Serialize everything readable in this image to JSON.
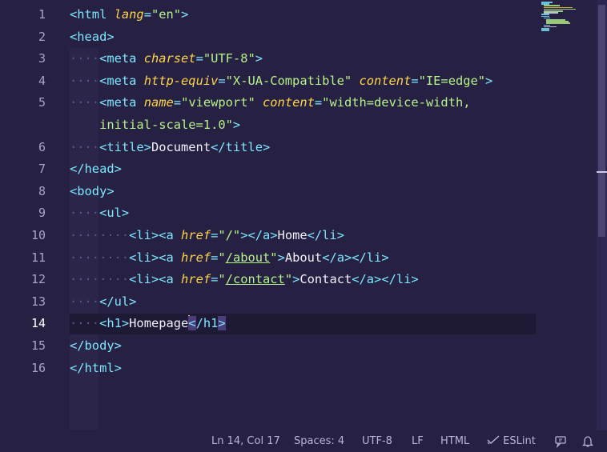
{
  "editor": {
    "line_numbers": [
      "1",
      "2",
      "3",
      "4",
      "5",
      "",
      "6",
      "7",
      "8",
      "9",
      "10",
      "11",
      "12",
      "13",
      "14",
      "15",
      "16"
    ],
    "active_line": "14",
    "lines": [
      [
        {
          "t": "tag",
          "v": "<html"
        },
        {
          "t": "plain",
          "v": " "
        },
        {
          "t": "attr",
          "v": "lang"
        },
        {
          "t": "tag",
          "v": "="
        },
        {
          "t": "str",
          "v": "\"en\""
        },
        {
          "t": "tag",
          "v": ">"
        }
      ],
      [
        {
          "t": "tag",
          "v": "<head>"
        }
      ],
      [
        {
          "t": "ws",
          "v": "····"
        },
        {
          "t": "tag",
          "v": "<meta"
        },
        {
          "t": "plain",
          "v": " "
        },
        {
          "t": "attr",
          "v": "charset"
        },
        {
          "t": "tag",
          "v": "="
        },
        {
          "t": "str",
          "v": "\"UTF-8\""
        },
        {
          "t": "tag",
          "v": ">"
        }
      ],
      [
        {
          "t": "ws",
          "v": "····"
        },
        {
          "t": "tag",
          "v": "<meta"
        },
        {
          "t": "plain",
          "v": " "
        },
        {
          "t": "attr",
          "v": "http-equiv"
        },
        {
          "t": "tag",
          "v": "="
        },
        {
          "t": "str",
          "v": "\"X-UA-Compatible\""
        },
        {
          "t": "plain",
          "v": " "
        },
        {
          "t": "attr",
          "v": "content"
        },
        {
          "t": "tag",
          "v": "="
        },
        {
          "t": "str",
          "v": "\"IE=edge\""
        },
        {
          "t": "tag",
          "v": ">"
        }
      ],
      [
        {
          "t": "ws",
          "v": "····"
        },
        {
          "t": "tag",
          "v": "<meta"
        },
        {
          "t": "plain",
          "v": " "
        },
        {
          "t": "attr",
          "v": "name"
        },
        {
          "t": "tag",
          "v": "="
        },
        {
          "t": "str",
          "v": "\"viewport\""
        },
        {
          "t": "plain",
          "v": " "
        },
        {
          "t": "attr",
          "v": "content"
        },
        {
          "t": "tag",
          "v": "="
        },
        {
          "t": "str",
          "v": "\"width=device-width,"
        }
      ],
      [
        {
          "t": "plain",
          "v": "    "
        },
        {
          "t": "str",
          "v": "initial-scale=1.0\""
        },
        {
          "t": "tag",
          "v": ">"
        }
      ],
      [
        {
          "t": "ws",
          "v": "····"
        },
        {
          "t": "tag",
          "v": "<title>"
        },
        {
          "t": "txt",
          "v": "Document"
        },
        {
          "t": "tag",
          "v": "</title>"
        }
      ],
      [
        {
          "t": "tag",
          "v": "</head>"
        }
      ],
      [
        {
          "t": "tag",
          "v": "<body>"
        }
      ],
      [
        {
          "t": "ws",
          "v": "····"
        },
        {
          "t": "tag",
          "v": "<ul>"
        }
      ],
      [
        {
          "t": "ws",
          "v": "········"
        },
        {
          "t": "tag",
          "v": "<li><a"
        },
        {
          "t": "plain",
          "v": " "
        },
        {
          "t": "attr",
          "v": "href"
        },
        {
          "t": "tag",
          "v": "="
        },
        {
          "t": "str",
          "v": "\"/\""
        },
        {
          "t": "tag",
          "v": "></a>"
        },
        {
          "t": "txt",
          "v": "Home"
        },
        {
          "t": "tag",
          "v": "</li>"
        }
      ],
      [
        {
          "t": "ws",
          "v": "········"
        },
        {
          "t": "tag",
          "v": "<li><a"
        },
        {
          "t": "plain",
          "v": " "
        },
        {
          "t": "attr",
          "v": "href"
        },
        {
          "t": "tag",
          "v": "="
        },
        {
          "t": "str",
          "v": "\""
        },
        {
          "t": "strul",
          "v": "/about"
        },
        {
          "t": "str",
          "v": "\""
        },
        {
          "t": "tag",
          "v": ">"
        },
        {
          "t": "txt",
          "v": "About"
        },
        {
          "t": "tag",
          "v": "</a></li>"
        }
      ],
      [
        {
          "t": "ws",
          "v": "········"
        },
        {
          "t": "tag",
          "v": "<li><a"
        },
        {
          "t": "plain",
          "v": " "
        },
        {
          "t": "attr",
          "v": "href"
        },
        {
          "t": "tag",
          "v": "="
        },
        {
          "t": "str",
          "v": "\""
        },
        {
          "t": "strul",
          "v": "/contact"
        },
        {
          "t": "str",
          "v": "\""
        },
        {
          "t": "tag",
          "v": ">"
        },
        {
          "t": "txt",
          "v": "Contact"
        },
        {
          "t": "tag",
          "v": "</a></li>"
        }
      ],
      [
        {
          "t": "ws",
          "v": "····"
        },
        {
          "t": "tag",
          "v": "</ul>"
        }
      ],
      [
        {
          "t": "ws",
          "v": "····"
        },
        {
          "t": "tag",
          "v": "<h1>"
        },
        {
          "t": "txt",
          "v": "Homepage"
        },
        {
          "t": "caret",
          "v": ""
        },
        {
          "t": "taghl",
          "v": "<"
        },
        {
          "t": "tag",
          "v": "/h1"
        },
        {
          "t": "taghl",
          "v": ">"
        }
      ],
      [
        {
          "t": "tag",
          "v": "</body>"
        }
      ],
      [
        {
          "t": "tag",
          "v": "</html>"
        }
      ]
    ]
  },
  "statusbar": {
    "position": "Ln 14, Col 17",
    "indent": "Spaces: 4",
    "encoding": "UTF-8",
    "eol": "LF",
    "language": "HTML",
    "linter": "ESLint",
    "linter_icon": "checkmark-icon",
    "feedback_icon": "feedback-icon",
    "bell_icon": "bell-icon"
  },
  "colors": {
    "background": "#262042",
    "tag": "#7ee7ff",
    "attribute": "#ffd54a",
    "string": "#b6f28a",
    "caret": "#ffcc33"
  }
}
